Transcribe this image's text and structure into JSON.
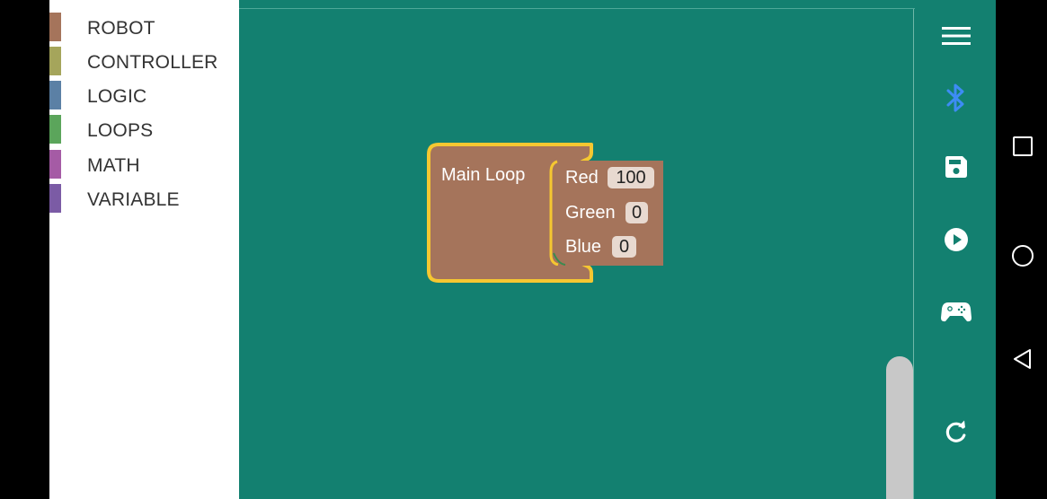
{
  "toolbox": {
    "categories": [
      {
        "label": "ROBOT",
        "color": "#a5745b"
      },
      {
        "label": "CONTROLLER",
        "color": "#a5a55b"
      },
      {
        "label": "LOGIC",
        "color": "#5b80a5"
      },
      {
        "label": "LOOPS",
        "color": "#5ba55b"
      },
      {
        "label": "MATH",
        "color": "#a55ba5"
      },
      {
        "label": "VARIABLE",
        "color": "#7b5ba5"
      }
    ]
  },
  "workspace": {
    "main_block": {
      "label": "Main Loop",
      "color": "#a5745b",
      "highlight": "#f5c731"
    },
    "color_block": {
      "color": "#a5745b",
      "rows": [
        {
          "label": "Red",
          "value": "100"
        },
        {
          "label": "Green",
          "value": "0"
        },
        {
          "label": "Blue",
          "value": "0"
        }
      ]
    }
  },
  "rail": {
    "buttons": [
      "menu-icon",
      "bluetooth-icon",
      "save-icon",
      "play-icon",
      "gamepad-icon",
      "refresh-icon"
    ],
    "bluetooth_color": "#3d8cf5"
  },
  "navbar": {
    "buttons": [
      "recents-icon",
      "home-icon",
      "back-icon"
    ]
  }
}
